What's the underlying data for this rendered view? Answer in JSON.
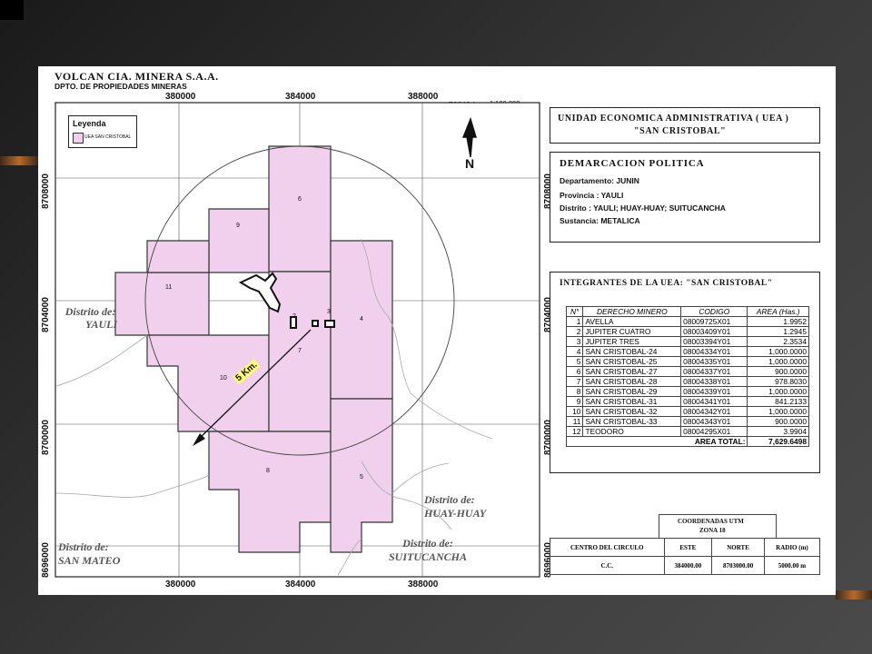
{
  "header": {
    "company": "VOLCAN CIA. MINERA S.A.A.",
    "department": "DPTO. DE PROPIEDADES MINERAS",
    "scale_label": "ESCALA:",
    "scale_value": "1:100,000"
  },
  "axes": {
    "x_ticks": [
      "380000",
      "384000",
      "388000"
    ],
    "y_ticks": [
      "8708000",
      "8704000",
      "8700000",
      "8696000"
    ]
  },
  "legend": {
    "title": "Leyenda",
    "item_label": "UEA SAN CRISTOBAL",
    "item_color": "#f0d0ec"
  },
  "map": {
    "block_numbers": [
      "6",
      "9",
      "11",
      "2",
      "3",
      "4",
      "7",
      "10",
      "8",
      "5"
    ],
    "radius_label": "5  Km.",
    "districts": [
      {
        "line1": "Distrito de:",
        "line2": "YAULI"
      },
      {
        "line1": "Distrito de:",
        "line2": "HUAY-HUAY"
      },
      {
        "line1": "Distrito de:",
        "line2": "SAN MATEO"
      },
      {
        "line1": "Distrito de:",
        "line2": "SUITUCANCHA"
      }
    ],
    "fill_color": "#f0d0ec",
    "topo_color": "#a8a8a8"
  },
  "uea": {
    "line1": "UNIDAD  ECONOMICA  ADMINISTRATIVA  ( UEA )",
    "line2": "\"SAN  CRISTOBAL\""
  },
  "demarcacion": {
    "title": "DEMARCACION  POLITICA",
    "rows": [
      "Departamento:  JUNIN",
      "Provincia   :  YAULI",
      "Distrito     :  YAULI; HUAY-HUAY; SUITUCANCHA",
      "Sustancia:  METALICA"
    ]
  },
  "integrantes": {
    "title": "INTEGRANTES  DE  LA  UEA:   \"SAN  CRISTOBAL\"",
    "headers": [
      "N°",
      "DERECHO MINERO",
      "CODIGO",
      "AREA (Has.)"
    ],
    "rows": [
      [
        "1",
        "AVELLA",
        "08009725X01",
        "1.9952"
      ],
      [
        "2",
        "JUPITER CUATRO",
        "08003409Y01",
        "1.2945"
      ],
      [
        "3",
        "JUPITER TRES",
        "08003394Y01",
        "2.3534"
      ],
      [
        "4",
        "SAN CRISTOBAL-24",
        "08004334Y01",
        "1,000.0000"
      ],
      [
        "5",
        "SAN CRISTOBAL-25",
        "08004335Y01",
        "1,000.0000"
      ],
      [
        "6",
        "SAN CRISTOBAL-27",
        "08004337Y01",
        "900.0000"
      ],
      [
        "7",
        "SAN CRISTOBAL-28",
        "08004338Y01",
        "978.8030"
      ],
      [
        "8",
        "SAN CRISTOBAL-29",
        "08004339Y01",
        "1,000.0000"
      ],
      [
        "9",
        "SAN CRISTOBAL-31",
        "08004341Y01",
        "841.2133"
      ],
      [
        "10",
        "SAN CRISTOBAL-32",
        "08004342Y01",
        "1,000.0000"
      ],
      [
        "11",
        "SAN CRISTOBAL-33",
        "08004343Y01",
        "900.0000"
      ],
      [
        "12",
        "TEODORO",
        "08004295X01",
        "3.9904"
      ]
    ],
    "total_label": "AREA TOTAL:",
    "total_value": "7,629.6498"
  },
  "utm": {
    "title1": "COORDENADAS  UTM",
    "title2": "ZONA 18",
    "headers": [
      "CENTRO  DEL  CIRCULO",
      "ESTE",
      "NORTE",
      "RADIO (m)"
    ],
    "row": [
      "C.C.",
      "384000.00",
      "8703000.00",
      "5000.00 m"
    ]
  }
}
